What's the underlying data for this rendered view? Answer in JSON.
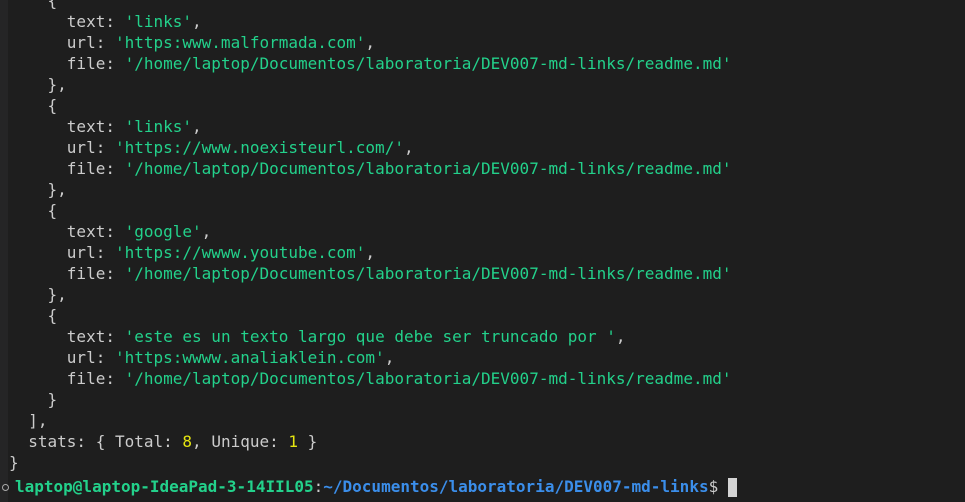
{
  "links": [
    {
      "text": "'links'",
      "url": "'https:www.malformada.com'",
      "file": "'/home/laptop/Documentos/laboratoria/DEV007-md-links/readme.md'"
    },
    {
      "text": "'links'",
      "url": "'https://www.noexisteurl.com/'",
      "file": "'/home/laptop/Documentos/laboratoria/DEV007-md-links/readme.md'"
    },
    {
      "text": "'google'",
      "url": "'https://wwww.youtube.com'",
      "file": "'/home/laptop/Documentos/laboratoria/DEV007-md-links/readme.md'"
    },
    {
      "text": "'este es un texto largo que debe ser truncado por '",
      "url": "'https:wwww.analiaklein.com'",
      "file": "'/home/laptop/Documentos/laboratoria/DEV007-md-links/readme.md'"
    }
  ],
  "keys": {
    "text": "text:",
    "url": "url:",
    "file": "file:",
    "stats": "stats:",
    "total": "Total:",
    "unique": "Unique:"
  },
  "stats": {
    "total": "8",
    "unique": "1"
  },
  "prompt": {
    "user_host": "laptop@laptop-IdeaPad-3-14IIL05",
    "separator": ":",
    "path": "~/Documentos/laboratoria/DEV007-md-links",
    "symbol": "$"
  },
  "colors": {
    "background": "#1e1e1e",
    "string": "#23d18b",
    "number": "#e5e510",
    "prompt_user": "#23d18b",
    "prompt_path": "#3b8eea"
  }
}
